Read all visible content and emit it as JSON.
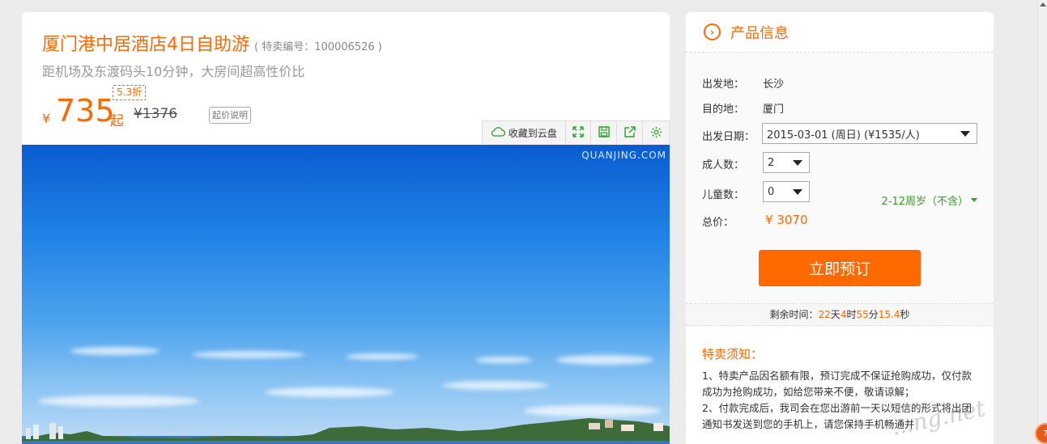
{
  "product": {
    "title": "厦门港中居酒店4日自助游",
    "code": "( 特卖编号：100006526 )",
    "subtitle": "距机场及东渡码头10分钟，大房间超高性价比",
    "currency": "¥",
    "price": "735",
    "price_suffix": "起",
    "discount": "5.3折",
    "original_price": "¥1376",
    "price_explain": "起价说明"
  },
  "toolbar": {
    "cloud_label": "收藏到云盘",
    "icons": [
      "fullscreen-icon",
      "save-icon",
      "share-icon",
      "settings-icon"
    ]
  },
  "photo": {
    "watermark": "QUANJING.COM"
  },
  "panel": {
    "title": "产品信息",
    "departure_label": "出发地：",
    "departure_value": "长沙",
    "destination_label": "目的地：",
    "destination_value": "厦门",
    "date_label": "出发日期：",
    "date_value": "2015-03-01 (周日) (¥1535/人)",
    "adults_label": "成人数：",
    "adults_value": "2",
    "children_label": "儿童数：",
    "children_value": "0",
    "age_note": "2-12周岁（不含）",
    "total_label": "总价：",
    "total_value": "¥ 3070",
    "book_label": "立即预订"
  },
  "timer": {
    "prefix": "剩余时间：",
    "days": "22",
    "days_unit": "天",
    "hours": "4",
    "hours_unit": "时",
    "minutes": "55",
    "minutes_unit": "分",
    "seconds": "15.4",
    "seconds_unit": "秒"
  },
  "notice": {
    "title": "特卖须知：",
    "line1": "1、特卖产品因名额有限，预订完成不保证抢购成功，仅付款成功为抢购成功，如给您带来不便，敬请谅解；",
    "line2": "2、付款完成后，我司会在您出游前一天以短信的形式将出团通知书发送到您的手机上，请您保持手机畅通并"
  },
  "colors": {
    "accent": "#ff6a00",
    "green": "#3c9a2a"
  },
  "watermark_overlay": "...ng.net",
  "float_button": "7"
}
